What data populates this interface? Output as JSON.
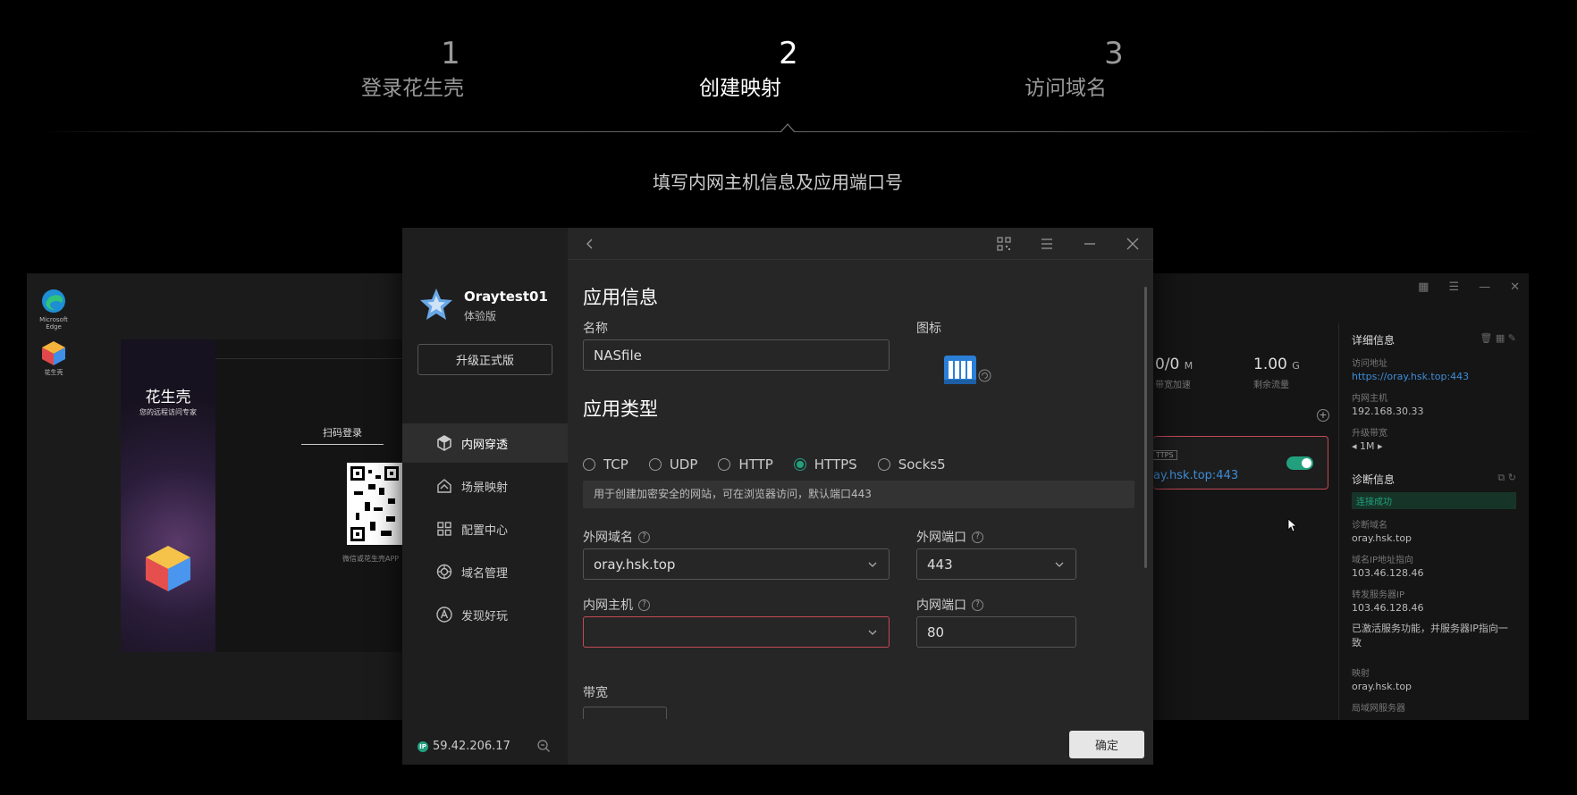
{
  "steps": [
    {
      "num": "1",
      "label": "登录花生壳"
    },
    {
      "num": "2",
      "label": "创建映射"
    },
    {
      "num": "3",
      "label": "访问域名"
    }
  ],
  "subtitle": "填写内网主机信息及应用端口号",
  "bg_left": {
    "desktop_icons": [
      {
        "label": "Microsoft Edge"
      },
      {
        "label": "花生壳"
      }
    ],
    "login": {
      "brand": "花生壳",
      "tagline": "您的远程访问专家",
      "scan_tab": "扫码登录",
      "qr_hint": "微信或花生壳APP"
    }
  },
  "bg_right": {
    "stats": [
      {
        "value": "0/0",
        "unit": "M",
        "label": "带宽加速"
      },
      {
        "value": "1.00",
        "unit": "G",
        "label": "剩余流量"
      }
    ],
    "mapping": {
      "tag": "TTPS",
      "domain": "ay.hsk.top:443"
    },
    "details": {
      "title": "详细信息",
      "access_label": "访问地址",
      "access_value": "https://oray.hsk.top:443",
      "host_label": "内网主机",
      "host_value": "192.168.30.33",
      "bw_label": "升级带宽",
      "bw_value": "1M"
    },
    "diagnosis": {
      "title": "诊断信息",
      "status": "连接成功",
      "domain_label": "诊断域名",
      "domain_value": "oray.hsk.top",
      "ip_label": "域名IP地址指向",
      "ip_value": "103.46.128.46",
      "fwd_label": "转发服务器IP",
      "fwd_value": "103.46.128.46",
      "note": "已激活服务功能，并服务器IP指向一致",
      "map_label": "映射",
      "map_value": "oray.hsk.top",
      "lan_label": "局域网服务器"
    }
  },
  "sidebar": {
    "username": "Oraytest01",
    "plan": "体验版",
    "upgrade_label": "升级正式版",
    "items": [
      {
        "label": "内网穿透",
        "icon": "cube-icon",
        "active": true
      },
      {
        "label": "场景映射",
        "icon": "scene-icon",
        "active": false
      },
      {
        "label": "配置中心",
        "icon": "grid-icon",
        "active": false
      },
      {
        "label": "域名管理",
        "icon": "domain-icon",
        "active": false
      },
      {
        "label": "发现好玩",
        "icon": "discover-icon",
        "active": false
      }
    ],
    "ip_badge": "IP",
    "ip": "59.42.206.17"
  },
  "form": {
    "app_info_title": "应用信息",
    "name_label": "名称",
    "name_value": "NASfile",
    "icon_label": "图标",
    "app_type_title": "应用类型",
    "types": [
      {
        "label": "TCP",
        "checked": false
      },
      {
        "label": "UDP",
        "checked": false
      },
      {
        "label": "HTTP",
        "checked": false
      },
      {
        "label": "HTTPS",
        "checked": true
      },
      {
        "label": "Socks5",
        "checked": false
      }
    ],
    "type_hint": "用于创建加密安全的网站，可在浏览器访问，默认端口443",
    "ext_domain_label": "外网域名",
    "ext_domain_value": "oray.hsk.top",
    "ext_port_label": "外网端口",
    "ext_port_value": "443",
    "lan_host_label": "内网主机",
    "lan_host_value": "",
    "lan_port_label": "内网端口",
    "lan_port_value": "80",
    "bandwidth_label": "带宽",
    "confirm_label": "确定"
  },
  "colors": {
    "accent": "#22a07e",
    "error": "#c34a55",
    "link": "#3d8dd8"
  }
}
